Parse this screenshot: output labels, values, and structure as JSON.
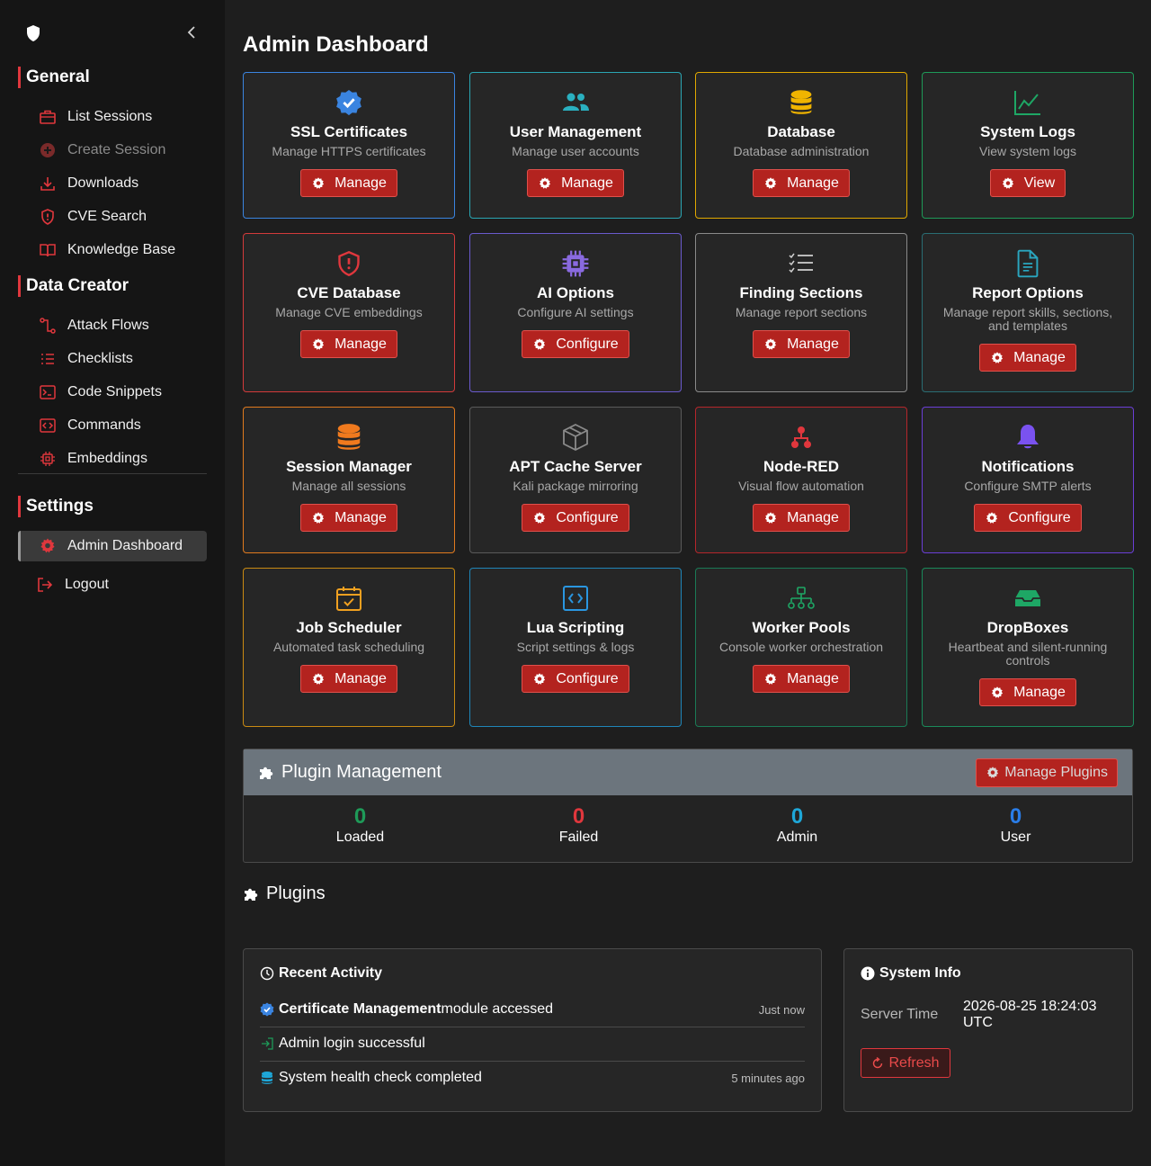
{
  "sidebar": {
    "sections": [
      {
        "title": "General",
        "items": [
          {
            "label": "List Sessions",
            "icon": "briefcase-icon"
          },
          {
            "label": "Create Session",
            "icon": "plus-circle-icon"
          },
          {
            "label": "Downloads",
            "icon": "download-icon"
          },
          {
            "label": "CVE Search",
            "icon": "shield-alert-icon"
          },
          {
            "label": "Knowledge Base",
            "icon": "book-open-icon"
          }
        ]
      },
      {
        "title": "Data Creator",
        "items": [
          {
            "label": "Attack Flows",
            "icon": "flow-icon"
          },
          {
            "label": "Checklists",
            "icon": "list-icon"
          },
          {
            "label": "Code Snippets",
            "icon": "terminal-icon"
          },
          {
            "label": "Commands",
            "icon": "code-icon"
          },
          {
            "label": "Embeddings",
            "icon": "chip-icon"
          }
        ]
      },
      {
        "title": "Settings",
        "items": [
          {
            "label": "Admin Dashboard",
            "icon": "gear-icon"
          },
          {
            "label": "Logout",
            "icon": "logout-icon"
          }
        ]
      }
    ]
  },
  "page": {
    "title": "Admin Dashboard"
  },
  "cards": [
    {
      "title": "SSL Certificates",
      "desc": "Manage HTTPS certificates",
      "button": "Manage",
      "border": "#3a84e0",
      "icon": "badge-check-icon"
    },
    {
      "title": "User Management",
      "desc": "Manage user accounts",
      "button": "Manage",
      "border": "#2aa6b3",
      "icon": "users-icon"
    },
    {
      "title": "Database",
      "desc": "Database administration",
      "button": "Manage",
      "border": "#e0a800",
      "icon": "database-icon"
    },
    {
      "title": "System Logs",
      "desc": "View system logs",
      "button": "View",
      "border": "#1e9a58",
      "icon": "chart-line-icon"
    },
    {
      "title": "CVE Database",
      "desc": "Manage CVE embeddings",
      "button": "Manage",
      "border": "#d23a3a",
      "icon": "shield-alert-icon"
    },
    {
      "title": "AI Options",
      "desc": "Configure AI settings",
      "button": "Configure",
      "border": "#6a5acd",
      "icon": "chip-icon"
    },
    {
      "title": "Finding Sections",
      "desc": "Manage report sections",
      "button": "Manage",
      "border": "#8a8a8a",
      "icon": "list-check-icon"
    },
    {
      "title": "Report Options",
      "desc": "Manage report skills, sections, and templates",
      "button": "Manage",
      "border": "#2a6d73",
      "icon": "document-icon"
    },
    {
      "title": "Session Manager",
      "desc": "Manage all sessions",
      "button": "Manage",
      "border": "#e07a1e",
      "icon": "database-stack-icon"
    },
    {
      "title": "APT Cache Server",
      "desc": "Kali package mirroring",
      "button": "Configure",
      "border": "#5a5a5a",
      "icon": "package-icon"
    },
    {
      "title": "Node-RED",
      "desc": "Visual flow automation",
      "button": "Manage",
      "border": "#b5262b",
      "icon": "nodes-icon"
    },
    {
      "title": "Notifications",
      "desc": "Configure SMTP alerts",
      "button": "Configure",
      "border": "#6a3ed6",
      "icon": "bell-icon"
    },
    {
      "title": "Job Scheduler",
      "desc": "Automated task scheduling",
      "button": "Manage",
      "border": "#c98a12",
      "icon": "calendar-check-icon"
    },
    {
      "title": "Lua Scripting",
      "desc": "Script settings & logs",
      "button": "Configure",
      "border": "#1f86b8",
      "icon": "code-square-icon"
    },
    {
      "title": "Worker Pools",
      "desc": "Console worker orchestration",
      "button": "Manage",
      "border": "#1a7a55",
      "icon": "hierarchy-icon"
    },
    {
      "title": "DropBoxes",
      "desc": "Heartbeat and silent-running controls",
      "button": "Manage",
      "border": "#1a8a5a",
      "icon": "inbox-icon"
    }
  ],
  "plugin_management": {
    "title": "Plugin Management",
    "button": "Manage Plugins",
    "stats": [
      {
        "value": "0",
        "label": "Loaded",
        "color": "#1e9a58"
      },
      {
        "value": "0",
        "label": "Failed",
        "color": "#e0373d"
      },
      {
        "value": "0",
        "label": "Admin",
        "color": "#1ea7d8"
      },
      {
        "value": "0",
        "label": "User",
        "color": "#2a7de8"
      }
    ]
  },
  "plugins": {
    "title": "Plugins"
  },
  "recent_activity": {
    "title": "Recent Activity",
    "items": [
      {
        "bold": "Certificate Management",
        "text": " module accessed",
        "time": "Just now",
        "icon": "badge-check-icon"
      },
      {
        "bold": "",
        "text": "Admin login successful",
        "time": "",
        "icon": "login-icon"
      },
      {
        "bold": "",
        "text": "System health check completed",
        "time": "5 minutes ago",
        "icon": "database-icon"
      }
    ]
  },
  "system_info": {
    "title": "System Info",
    "server_time_label": "Server Time",
    "server_time_value": "2026-08-25 18:24:03 UTC",
    "refresh": "Refresh"
  }
}
